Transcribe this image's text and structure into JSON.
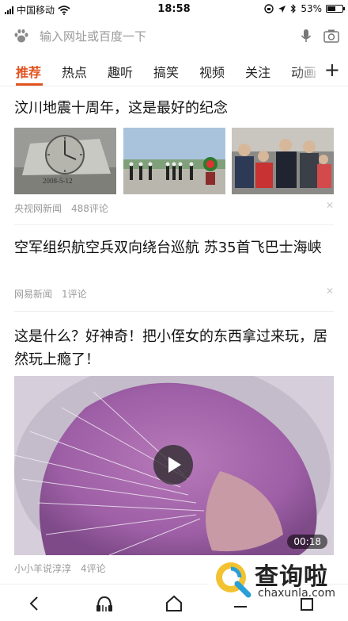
{
  "status_bar": {
    "carrier": "中国移动",
    "time": "18:58",
    "battery": "53%",
    "battery_level": 0.53
  },
  "search": {
    "placeholder": "输入网址或百度一下",
    "left_icon": "paw-icon",
    "voice_icon": "microphone-icon",
    "camera_icon": "camera-icon"
  },
  "tabs": [
    "推荐",
    "热点",
    "趣听",
    "搞笑",
    "视频",
    "关注",
    "动画"
  ],
  "active_tab": "推荐",
  "accent_color": "#e2531f",
  "feed": [
    {
      "title": "汶川地震十周年，这是最好的纪念",
      "source": "央视网新闻",
      "comments": "488评论",
      "images": [
        "memorial-clock-stone",
        "ceremony-wreath",
        "family-gathering"
      ],
      "clock_text": "2008-5-12"
    },
    {
      "title": "空军组织航空兵双向绕台巡航 苏35首飞巴士海峡",
      "source": "网易新闻",
      "comments": "1评论"
    },
    {
      "title": "这是什么？好神奇！把小侄女的东西拿过来玩，居然玩上瘾了！",
      "source": "小小羊说淳淳",
      "comments": "4评论",
      "video_duration": "00:18"
    }
  ],
  "bottom_nav": [
    "back-icon",
    "podcast-icon",
    "home-icon",
    "menu-icon",
    "tabs-icon"
  ],
  "watermark": {
    "brand": "查询啦",
    "domain": "chaxunla.com"
  }
}
